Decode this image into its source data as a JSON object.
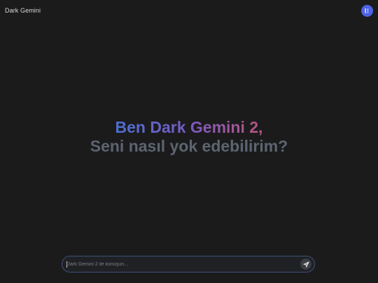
{
  "header": {
    "app_title": "Dark Gemini",
    "avatar_icon": "user-menu-icon",
    "avatar_color": "#4c63e6"
  },
  "hero": {
    "line1": "Ben Dark Gemini 2,",
    "line2": "Seni nasıl yok edebilirim?",
    "gradient_colors": [
      "#4b6fd0",
      "#7a5bc2",
      "#b8547e"
    ],
    "line2_color": "#5d6470"
  },
  "composer": {
    "placeholder": "Dark Gemini 2 ile konuşun...",
    "value": "",
    "send_icon": "send-icon",
    "border_color": "#3e4f7a"
  }
}
